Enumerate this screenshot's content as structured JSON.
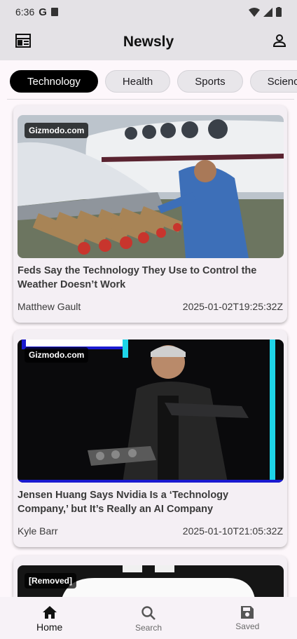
{
  "status": {
    "time": "6:36",
    "google": "G"
  },
  "app": {
    "title": "Newsly"
  },
  "categories": [
    "Technology",
    "Health",
    "Sports",
    "Science"
  ],
  "articles": [
    {
      "source": "Gizmodo.com",
      "headline": "Feds Say the Technology They Use to Control the Weather Doesn’t Work",
      "author": "Matthew Gault",
      "date": "2025-01-02T19:25:32Z"
    },
    {
      "source": "Gizmodo.com",
      "headline": "Jensen Huang Says Nvidia Is a ‘Technology Company,’ but It’s Really an AI Company",
      "author": "Kyle Barr",
      "date": "2025-01-10T21:05:32Z"
    },
    {
      "source": "[Removed]"
    }
  ],
  "nav": {
    "home": "Home",
    "search": "Search",
    "saved": "Saved"
  },
  "colors": {
    "active_chip": "#000000",
    "appbar": "#e4e2e6",
    "card": "#f4eff4"
  }
}
